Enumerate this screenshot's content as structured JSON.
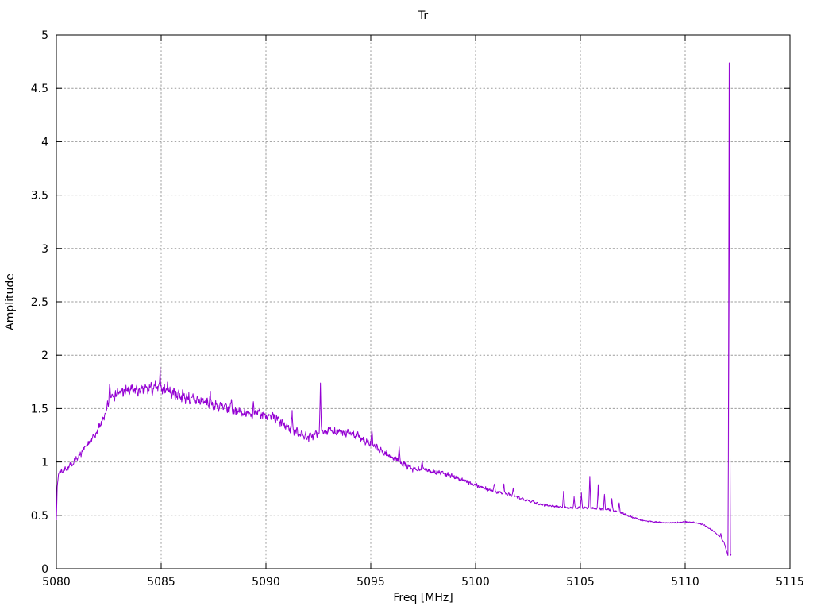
{
  "chart_data": {
    "type": "line",
    "title": "Tr",
    "xlabel": "Freq [MHz]",
    "ylabel": "Amplitude",
    "xlim": [
      5080,
      5115
    ],
    "ylim": [
      0,
      5
    ],
    "xticks": [
      5080,
      5085,
      5090,
      5095,
      5100,
      5105,
      5110,
      5115
    ],
    "yticks": [
      0,
      0.5,
      1,
      1.5,
      2,
      2.5,
      3,
      3.5,
      4,
      4.5,
      5
    ],
    "grid": true,
    "legend_position": "none",
    "line_color": "#9400d3",
    "grid_color": "#9c9c9c",
    "border_color": "#000000",
    "background": "#ffffff",
    "series": [
      {
        "name": "Tr",
        "x_start": 5080.0,
        "x_end": 5112.2,
        "envelope": [
          [
            5080.0,
            0.46
          ],
          [
            5080.04,
            0.75
          ],
          [
            5080.1,
            0.9
          ],
          [
            5080.3,
            0.92
          ],
          [
            5080.6,
            0.95
          ],
          [
            5081.0,
            1.04
          ],
          [
            5081.5,
            1.16
          ],
          [
            5082.0,
            1.3
          ],
          [
            5082.35,
            1.45
          ],
          [
            5082.6,
            1.62
          ],
          [
            5083.0,
            1.65
          ],
          [
            5083.5,
            1.67
          ],
          [
            5084.0,
            1.67
          ],
          [
            5084.5,
            1.69
          ],
          [
            5085.0,
            1.69
          ],
          [
            5085.5,
            1.65
          ],
          [
            5086.0,
            1.62
          ],
          [
            5086.5,
            1.58
          ],
          [
            5087.0,
            1.57
          ],
          [
            5087.5,
            1.53
          ],
          [
            5088.0,
            1.51
          ],
          [
            5088.5,
            1.48
          ],
          [
            5089.0,
            1.46
          ],
          [
            5089.5,
            1.45
          ],
          [
            5090.0,
            1.44
          ],
          [
            5090.5,
            1.4
          ],
          [
            5091.0,
            1.33
          ],
          [
            5091.5,
            1.28
          ],
          [
            5092.0,
            1.23
          ],
          [
            5092.5,
            1.27
          ],
          [
            5093.0,
            1.29
          ],
          [
            5093.5,
            1.28
          ],
          [
            5094.0,
            1.27
          ],
          [
            5094.5,
            1.23
          ],
          [
            5095.0,
            1.17
          ],
          [
            5095.5,
            1.1
          ],
          [
            5096.0,
            1.05
          ],
          [
            5096.5,
            0.99
          ],
          [
            5097.0,
            0.93
          ],
          [
            5097.5,
            0.93
          ],
          [
            5098.0,
            0.91
          ],
          [
            5098.5,
            0.89
          ],
          [
            5099.0,
            0.86
          ],
          [
            5099.5,
            0.82
          ],
          [
            5100.0,
            0.78
          ],
          [
            5100.5,
            0.75
          ],
          [
            5101.0,
            0.72
          ],
          [
            5101.5,
            0.7
          ],
          [
            5102.0,
            0.67
          ],
          [
            5102.5,
            0.64
          ],
          [
            5103.0,
            0.61
          ],
          [
            5103.5,
            0.59
          ],
          [
            5104.0,
            0.58
          ],
          [
            5104.5,
            0.57
          ],
          [
            5105.0,
            0.57
          ],
          [
            5105.5,
            0.57
          ],
          [
            5106.0,
            0.56
          ],
          [
            5106.5,
            0.55
          ],
          [
            5107.0,
            0.52
          ],
          [
            5107.5,
            0.48
          ],
          [
            5108.0,
            0.45
          ],
          [
            5108.5,
            0.44
          ],
          [
            5109.0,
            0.43
          ],
          [
            5109.5,
            0.43
          ],
          [
            5110.0,
            0.44
          ],
          [
            5110.5,
            0.43
          ],
          [
            5110.9,
            0.41
          ],
          [
            5111.3,
            0.36
          ],
          [
            5111.6,
            0.31
          ],
          [
            5111.85,
            0.25
          ],
          [
            5112.0,
            0.15
          ],
          [
            5112.05,
            0.12
          ],
          [
            5112.2,
            0.13
          ]
        ],
        "spikes": [
          [
            5082.55,
            1.74
          ],
          [
            5084.95,
            1.85
          ],
          [
            5085.3,
            1.76
          ],
          [
            5087.35,
            1.64
          ],
          [
            5088.35,
            1.6
          ],
          [
            5089.4,
            1.55
          ],
          [
            5091.25,
            1.46
          ],
          [
            5092.6,
            1.74
          ],
          [
            5095.05,
            1.28
          ],
          [
            5096.35,
            1.15
          ],
          [
            5097.45,
            1.01
          ],
          [
            5100.9,
            0.8
          ],
          [
            5101.35,
            0.78
          ],
          [
            5101.8,
            0.75
          ],
          [
            5104.2,
            0.74
          ],
          [
            5104.7,
            0.67
          ],
          [
            5105.05,
            0.7
          ],
          [
            5105.45,
            0.86
          ],
          [
            5105.85,
            0.78
          ],
          [
            5106.15,
            0.7
          ],
          [
            5106.5,
            0.66
          ],
          [
            5106.85,
            0.62
          ],
          [
            5111.7,
            0.33
          ],
          [
            5112.1,
            4.74
          ]
        ],
        "noise": {
          "seed": 7,
          "base": 0.005,
          "scale": 0.028,
          "floor": 0.4
        }
      }
    ]
  }
}
